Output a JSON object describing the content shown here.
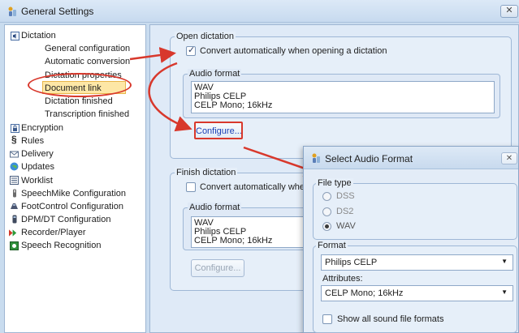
{
  "window": {
    "title": "General Settings",
    "close_glyph": "✕"
  },
  "sidebar": {
    "items": [
      {
        "label": "Dictation",
        "icon": "speaker-icon"
      },
      {
        "label": "General configuration"
      },
      {
        "label": "Automatic conversion",
        "selected": true
      },
      {
        "label": "Dictation properties"
      },
      {
        "label": "Document link"
      },
      {
        "label": "Dictation finished"
      },
      {
        "label": "Transcription finished"
      },
      {
        "label": "Encryption",
        "icon": "lock-icon"
      },
      {
        "label": "Rules",
        "icon": "section-icon"
      },
      {
        "label": "Delivery",
        "icon": "envelope-icon"
      },
      {
        "label": "Updates",
        "icon": "globe-icon"
      },
      {
        "label": "Worklist",
        "icon": "list-icon"
      },
      {
        "label": "SpeechMike Configuration",
        "icon": "microphone-icon"
      },
      {
        "label": "FootControl Configuration",
        "icon": "footcontrol-icon"
      },
      {
        "label": "DPM/DT Configuration",
        "icon": "recorder-icon"
      },
      {
        "label": "Recorder/Player",
        "icon": "play-icon"
      },
      {
        "label": "Speech Recognition",
        "icon": "speech-icon"
      }
    ]
  },
  "open_dictation": {
    "title": "Open dictation",
    "convert_label": "Convert automatically when opening a dictation",
    "audio_format_title": "Audio format",
    "audio_format_lines": [
      "WAV",
      "Philips CELP",
      "CELP  Mono; 16kHz"
    ],
    "configure_label": "Configure..."
  },
  "finish_dictation": {
    "title": "Finish dictation",
    "convert_label": "Convert automatically when f",
    "audio_format_title": "Audio format",
    "audio_format_lines": [
      "WAV",
      "Philips CELP",
      "CELP  Mono; 16kHz"
    ],
    "configure_label": "Configure..."
  },
  "dialog": {
    "title": "Select Audio Format",
    "close_glyph": "✕",
    "file_type_title": "File type",
    "file_types": [
      {
        "label": "DSS",
        "checked": false
      },
      {
        "label": "DS2",
        "checked": false
      },
      {
        "label": "WAV",
        "checked": true
      }
    ],
    "format_title": "Format",
    "format_value": "Philips CELP",
    "attributes_label": "Attributes:",
    "attributes_value": "CELP  Mono; 16kHz",
    "show_all_label": "Show all sound file formats"
  },
  "colors": {
    "annotation_red": "#d8382c",
    "selection": "#fde7a6"
  }
}
